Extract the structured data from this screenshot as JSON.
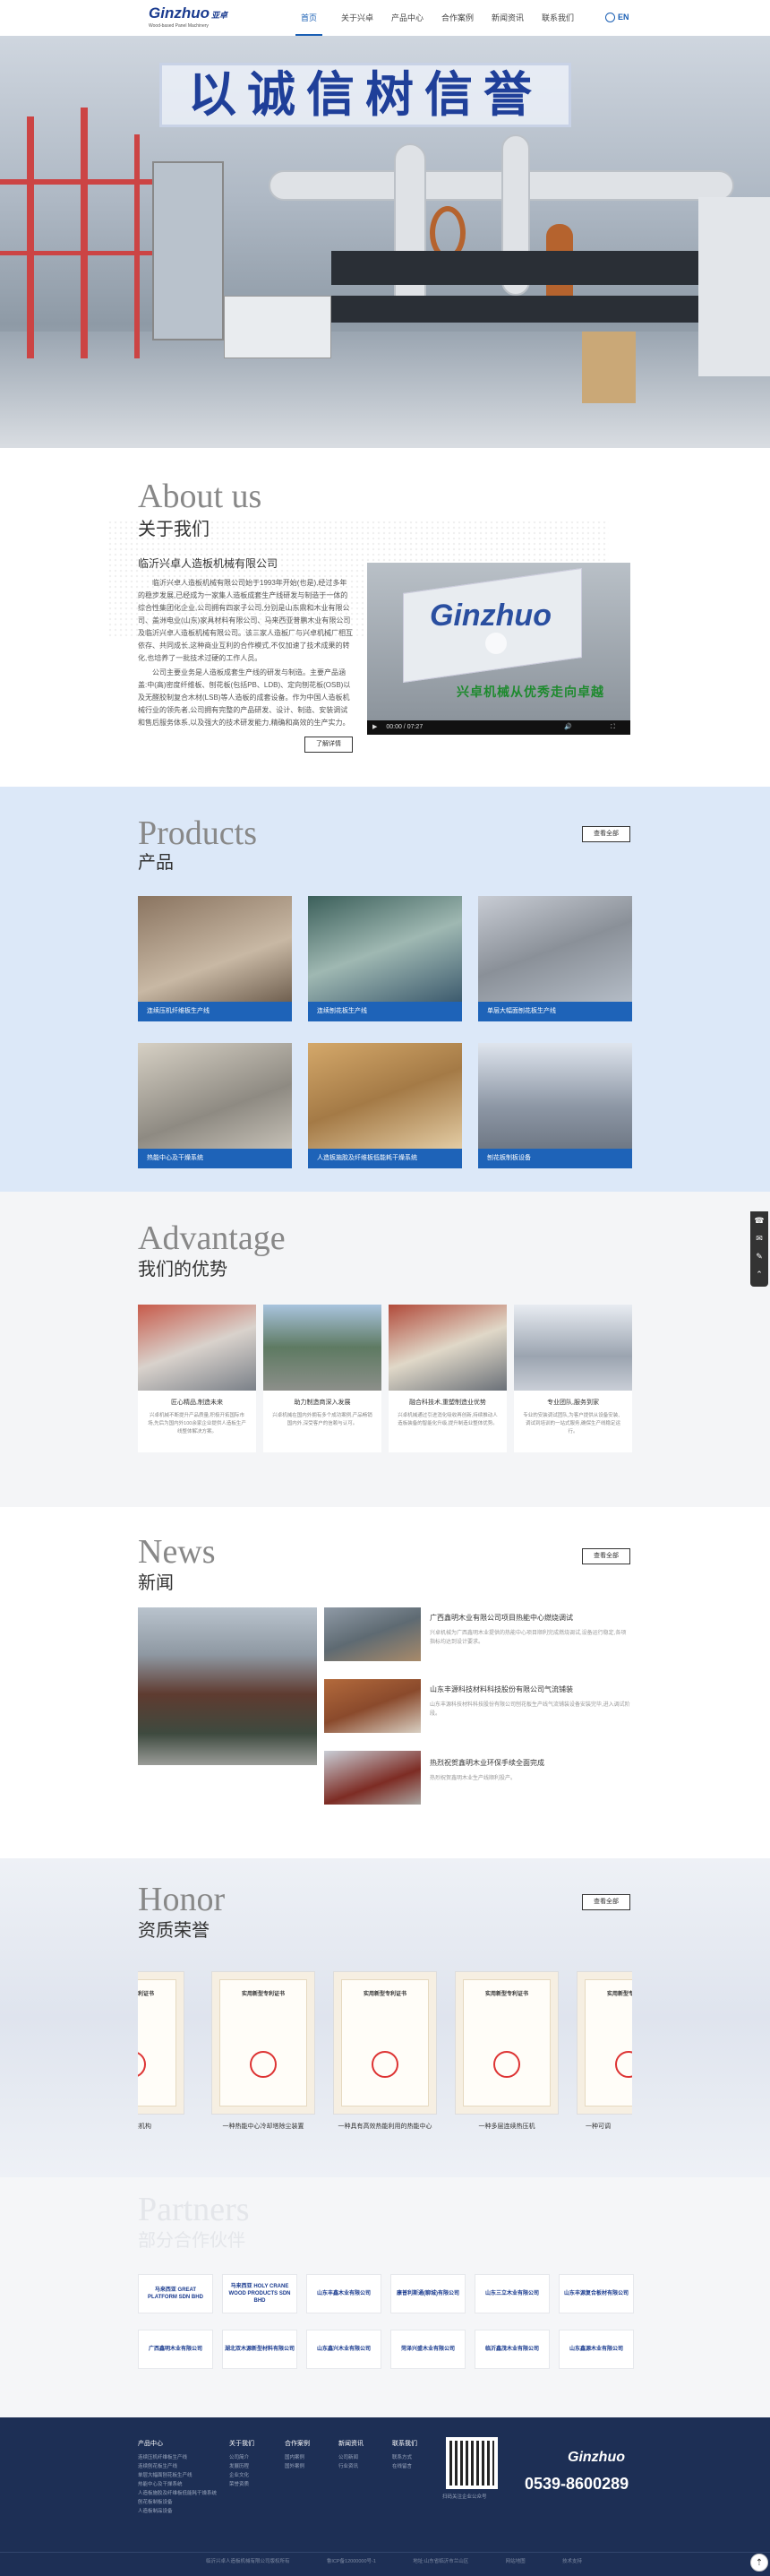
{
  "header": {
    "logo_text": "Ginzhuo",
    "logo_cn": "亚卓",
    "logo_sub": "Wood-based Panel Machinery",
    "nav": [
      "首页",
      "关于兴卓",
      "产品中心",
      "合作案例",
      "新闻资讯",
      "联系我们"
    ],
    "lang_icon": "globe-icon",
    "lang": "EN"
  },
  "hero": {
    "slogan": "以诚信树信誉"
  },
  "about": {
    "en": "About us",
    "cn": "关于我们",
    "company": "临沂兴卓人造板机械有限公司",
    "p1": "临沂兴卓人造板机械有限公司始于1993年开始(也是),经过多年的稳步发展,已经成为一家集人造板成套生产线研发与制造于一体的综合性集团化企业,公司拥有四家子公司,分别是山东鼎和木业有限公司、盖洲电业(山东)家具材料有限公司、马来西亚普鹏木业有限公司及临沂兴卓人造板机械有限公司。该三家人造板厂与兴卓机械厂相互依存、共同成长,这种商业互利的合作模式,不仅加速了技术成果的转化,也培养了一批技术过硬的工作人员。",
    "p2": "公司主要业务是人造板成套生产线的研发与制造。主要产品涵盖:中(高)密度纤维板、刨花板(包括PB、LDB)、定向刨花板(OSB)以及无醛胶制复合木材(LSB)等人造板的成套设备。作为中国人造板机械行业的领先者,公司拥有完整的产品研发、设计、制造、安装调试和售后服务体系,以及强大的技术研发能力,精确和高效的生产实力。",
    "more": "了解详情",
    "video_caption": "兴卓机械从优秀走向卓越",
    "video_time": "00:00 / 07:27",
    "video_brand": "Ginzhuo"
  },
  "products": {
    "en": "Products",
    "cn": "产品",
    "more": "查看全部",
    "items": [
      "连续压机纤维板生产线",
      "连续刨花板生产线",
      "单层大幅面刨花板生产线",
      "热能中心及干燥系统",
      "人造板施胶及纤维板低能耗干燥系统",
      "刨花板制板设备"
    ]
  },
  "advantage": {
    "en": "Advantage",
    "cn": "我们的优势",
    "items": [
      {
        "title": "匠心精品,制造未来",
        "text": "兴卓机械不断提升产品质量,积极开拓国际市场,先后为国内外100余家企业提供人造板生产线整体解决方案。"
      },
      {
        "title": "助力制造商深入发展",
        "text": "兴卓机械在国内外拥有多个成功案例,产品畅销国内外,深受客户的信赖与认可。"
      },
      {
        "title": "融合科技术,重塑制造业优势",
        "text": "兴卓机械通过引进消化吸收再创新,持续推动人造板装备的智能化升级,提升制造业整体优势。"
      },
      {
        "title": "专业团队,服务到家",
        "text": "专业的安装调试团队,为客户提供从设备安装、调试到培训的一站式服务,确保生产线稳定运行。"
      }
    ]
  },
  "news": {
    "en": "News",
    "cn": "新闻",
    "more": "查看全部",
    "items": [
      {
        "title": "广西鑫明木业有限公司项目热能中心燃烧调试",
        "text": "兴卓机械为广西鑫明木业提供的热能中心项目顺利完成燃烧调试,设备运行稳定,各项指标均达到设计要求。"
      },
      {
        "title": "山东丰源科技材料科技股份有限公司气流铺装",
        "text": "山东丰源科技材料科技股份有限公司刨花板生产线气流铺装设备安装完毕,进入调试阶段。"
      },
      {
        "title": "热烈祝贺鑫明木业环保手续全面完成",
        "text": "热烈祝贺鑫明木业生产线顺利投产。"
      }
    ]
  },
  "honor": {
    "en": "Honor",
    "cn": "资质荣誉",
    "more": "查看全部",
    "cert_title": "实用新型专利证书",
    "items": [
      "刨花铺装机构",
      "一种热能中心冷却塔除尘装置",
      "一种具有高效热能利用的热能中心",
      "一种多层连续热压机",
      "一种可调"
    ]
  },
  "partners": {
    "en": "Partners",
    "cn": "部分合作伙伴",
    "items": [
      "马来西亚 GREAT PLATFORM SDN BHD",
      "马来西亚 HOLY CRANE WOOD PRODUCTS SDN BHD",
      "山东丰鑫木业有限公司",
      "康普利斯通(聊城)有限公司",
      "山东三立木业有限公司",
      "山东丰源复合板材有限公司",
      "广西鑫明木业有限公司",
      "湖北双木源新型材料有限公司",
      "山东鑫兴木业有限公司",
      "菏泽兴盛木业有限公司",
      "临沂鑫茂木业有限公司",
      "山东鑫源木业有限公司"
    ]
  },
  "footer": {
    "cols": [
      {
        "head": "产品中心",
        "links": [
          "连续压机纤维板生产线",
          "连续刨花板生产线",
          "单层大幅面刨花板生产线",
          "热能中心及干燥系统",
          "人造板施胶及纤维板低能耗干燥系统",
          "刨花板制板设备",
          "人造板制品设备"
        ]
      },
      {
        "head": "关于我们",
        "links": [
          "公司简介",
          "发展历程",
          "企业文化",
          "荣誉资质"
        ]
      },
      {
        "head": "合作案例",
        "links": [
          "国内案例",
          "国外案例"
        ]
      },
      {
        "head": "新闻资讯",
        "links": [
          "公司新闻",
          "行业资讯"
        ]
      },
      {
        "head": "联系我们",
        "links": [
          "联系方式",
          "在线留言"
        ]
      }
    ],
    "qr_caption": "扫码关注企业公众号",
    "brand": "Ginzhuo",
    "phone": "0539-8600289",
    "bottom": [
      "临沂兴卓人造板机械有限公司版权所有",
      "鲁ICP备12000000号-1",
      "地址:山东省临沂市兰山区",
      "网站地图",
      "技术支持"
    ]
  },
  "side": [
    "phone-icon",
    "wechat-icon",
    "form-icon",
    "top-icon"
  ]
}
